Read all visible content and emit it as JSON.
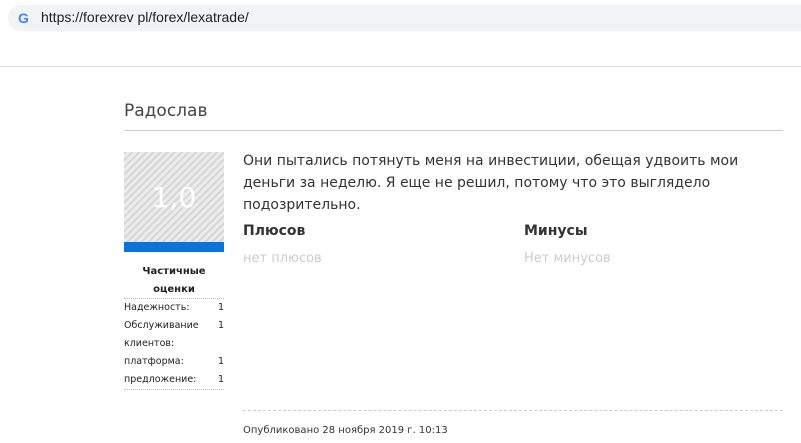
{
  "browser": {
    "url": "https://forexrev pl/forex/lexatrade/",
    "icon": "google-icon"
  },
  "review": {
    "author": "Радослав",
    "score": "1,0",
    "score_fraction": 0.2,
    "partial_title": "Частичные оценки",
    "ratings": [
      {
        "label": "Надежность:",
        "value": "1"
      },
      {
        "label": "Обслуживание клиентов:",
        "value": "1"
      },
      {
        "label": "платформа:",
        "value": "1"
      },
      {
        "label": "предложение:",
        "value": "1"
      }
    ],
    "text": "Они пытались потянуть меня на инвестиции, обещая удвоить мои деньги за неделю. Я еще не решил, потому что это выглядело подозрительно.",
    "pros_title": "Плюсов",
    "pros": "нет плюсов",
    "cons_title": "Минусы",
    "cons": "Нет минусов",
    "published": "Опубликовано 28 ноября 2019 г. 10:13"
  }
}
